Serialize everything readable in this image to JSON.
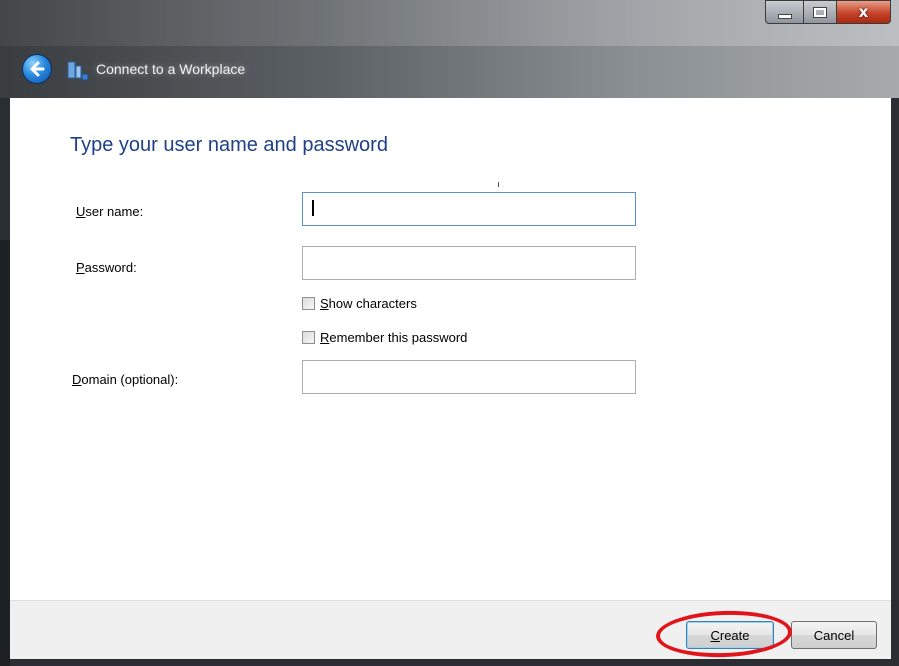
{
  "window": {
    "title": "Connect to a Workplace",
    "controls": {
      "close_glyph": "x"
    }
  },
  "page": {
    "heading": "Type your user name and password"
  },
  "form": {
    "username": {
      "label_access_key": "U",
      "label_rest": "ser name:",
      "value": ""
    },
    "password": {
      "label_access_key": "P",
      "label_rest": "assword:",
      "value": ""
    },
    "show_characters": {
      "label_access_key": "S",
      "label_rest": "how characters",
      "checked": false
    },
    "remember_password": {
      "label_access_key": "R",
      "label_rest": "emember this password",
      "checked": false
    },
    "domain": {
      "label_access_key": "D",
      "label_rest": "omain (optional):",
      "value": ""
    }
  },
  "footer": {
    "create": {
      "label_access_key": "C",
      "label_rest": "reate"
    },
    "cancel": {
      "label": "Cancel"
    }
  },
  "colors": {
    "heading": "#1e3f8a",
    "annotation": "#e0141a",
    "close_button": "#c6432a"
  },
  "icons": [
    "back-arrow-icon",
    "network-workplace-icon",
    "minimize-icon",
    "maximize-icon",
    "close-icon"
  ]
}
